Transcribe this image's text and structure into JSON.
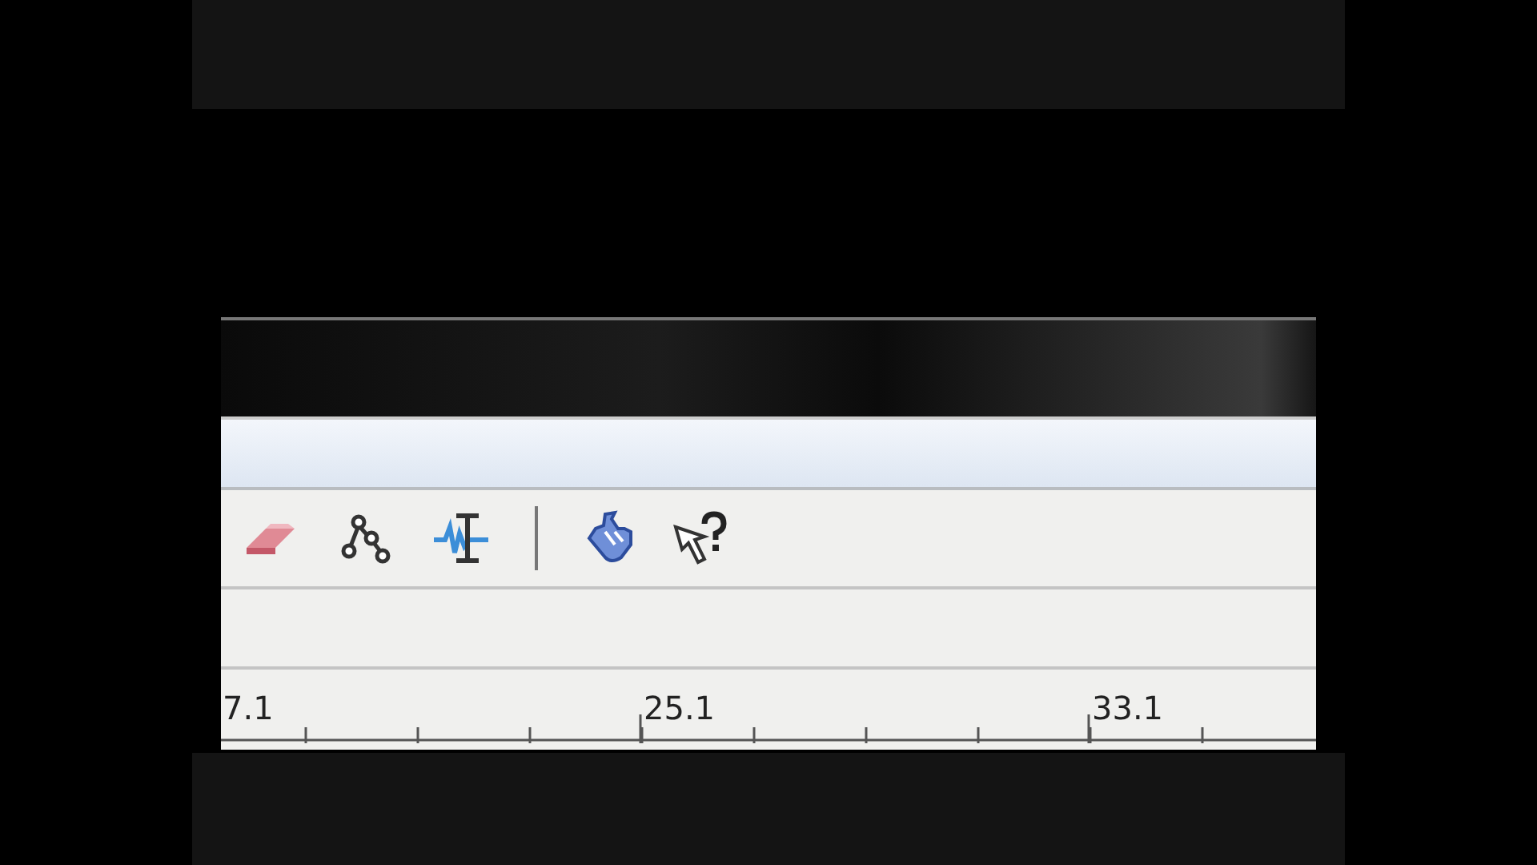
{
  "toolbar": {
    "tools": [
      {
        "kind": "eraser"
      },
      {
        "kind": "nodes"
      },
      {
        "kind": "wave-cursor"
      },
      {
        "kind": "separator"
      },
      {
        "kind": "hand"
      },
      {
        "kind": "help-pointer"
      }
    ]
  },
  "ruler": {
    "labels": [
      "7.1",
      "25.1",
      "33.1"
    ]
  }
}
